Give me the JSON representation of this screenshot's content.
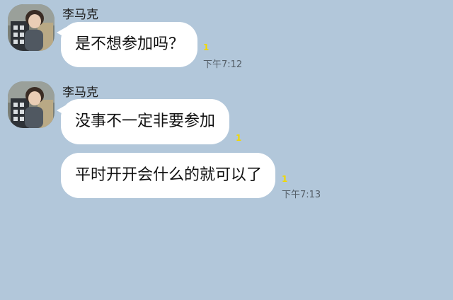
{
  "messages": [
    {
      "sender": "李马克",
      "bubbles": [
        {
          "text": "是不想参加吗？",
          "unread": "1",
          "time": "下午7:12"
        }
      ]
    },
    {
      "sender": "李马克",
      "bubbles": [
        {
          "text": "没事不一定非要参加",
          "unread": "1",
          "time": ""
        },
        {
          "text": "平时开开会什么的就可以了",
          "unread": "1",
          "time": "下午7:13"
        }
      ]
    }
  ],
  "colors": {
    "background": "#b2c7da",
    "bubble": "#ffffff",
    "unread": "#f2d800"
  }
}
